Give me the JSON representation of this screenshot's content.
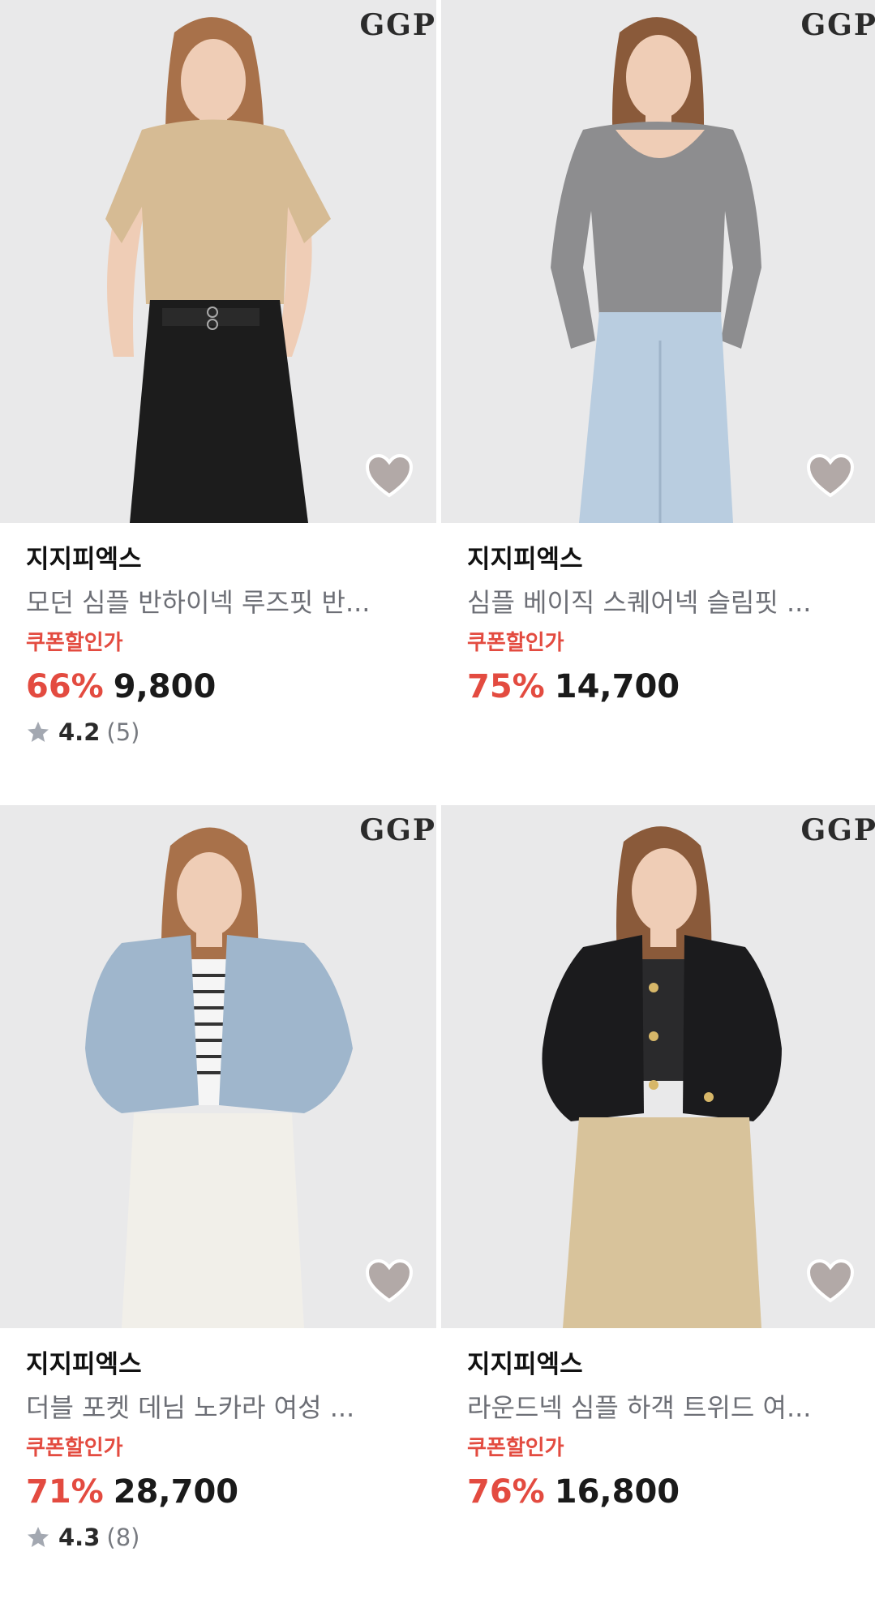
{
  "products": [
    {
      "photo_brand_mark": "GGP",
      "brand": "지지피엑스",
      "name": "모던 심플 반하이넥 루즈핏 반...",
      "coupon_label": "쿠폰할인가",
      "discount": "66%",
      "price": "9,800",
      "rating": "4.2",
      "review_count": "(5)",
      "colors": {
        "top": "#d6bb94",
        "bottom": "#1c1c1c",
        "skin": "#efcdb6",
        "hair": "#a8714a"
      }
    },
    {
      "photo_brand_mark": "GGP",
      "brand": "지지피엑스",
      "name": "심플 베이직 스퀘어넥 슬림핏 ...",
      "coupon_label": "쿠폰할인가",
      "discount": "75%",
      "price": "14,700",
      "colors": {
        "top": "#8d8d8f",
        "bottom": "#b9cde0",
        "skin": "#efcdb6",
        "hair": "#8a5a3a"
      }
    },
    {
      "photo_brand_mark": "GGP",
      "brand": "지지피엑스",
      "name": "더블 포켓 데님 노카라 여성 ...",
      "coupon_label": "쿠폰할인가",
      "discount": "71%",
      "price": "28,700",
      "rating": "4.3",
      "review_count": "(8)",
      "colors": {
        "top": "#9fb6cc",
        "bottom": "#f1efe9",
        "skin": "#efcdb6",
        "hair": "#a8714a"
      }
    },
    {
      "photo_brand_mark": "GGP",
      "brand": "지지피엑스",
      "name": "라운드넥 심플 하객 트위드 여...",
      "coupon_label": "쿠폰할인가",
      "discount": "76%",
      "price": "16,800",
      "colors": {
        "top": "#1b1b1d",
        "bottom": "#d8c39b",
        "skin": "#efcdb6",
        "hair": "#8a5a3a"
      }
    }
  ],
  "icons": {
    "wishlist": "heart-icon",
    "rating": "star-icon"
  },
  "colors": {
    "accent_red": "#e34b40",
    "photo_bg": "#e9e9ea",
    "heart_fill": "#a89e9b",
    "star": "#a3a8b1"
  }
}
